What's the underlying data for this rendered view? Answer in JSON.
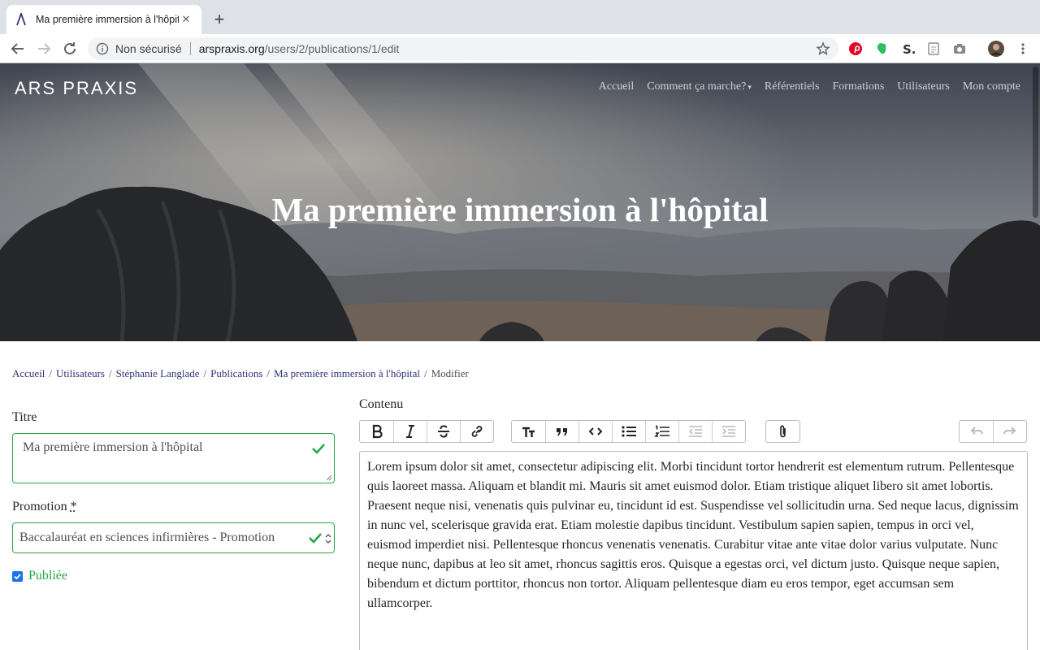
{
  "browser": {
    "tab_title": "Ma première immersion à l'hôpital",
    "close_glyph": "✕",
    "new_tab_glyph": "+",
    "security_label": "Non sécurisé",
    "url_host": "arspraxis.org",
    "url_path": "/users/2/publications/1/edit",
    "extensions": [
      "pinterest-icon",
      "evernote-icon",
      "dollar-icon",
      "document-icon",
      "camera-icon",
      "profile-avatar",
      "menu-icon"
    ]
  },
  "header": {
    "brand": "ARS PRAXIS",
    "nav": [
      {
        "label": "Accueil"
      },
      {
        "label": "Comment ça marche?",
        "dropdown": true,
        "caret": "▾"
      },
      {
        "label": "Référentiels"
      },
      {
        "label": "Formations"
      },
      {
        "label": "Utilisateurs"
      },
      {
        "label": "Mon compte"
      }
    ],
    "page_title": "Ma première immersion à l'hôpital"
  },
  "breadcrumb": {
    "items": [
      "Accueil",
      "Utilisateurs",
      "Stéphanie Langlade",
      "Publications",
      "Ma première immersion à l'hôpital"
    ],
    "current": "Modifier",
    "separator": "/"
  },
  "form": {
    "title_label": "Titre",
    "title_value": "Ma première immersion à l'hôpital",
    "promotion_label": "Promotion",
    "required_mark": "*",
    "promotion_value": "Baccalauréat en sciences infirmières - Promotion",
    "published_label": "Publiée",
    "published_checked": true,
    "content_label": "Contenu",
    "valid_color": "#28a745"
  },
  "editor": {
    "toolbar": [
      "bold-icon",
      "italic-icon",
      "strikethrough-icon",
      "link-icon",
      "heading-icon",
      "quote-icon",
      "code-icon",
      "bullet-list-icon",
      "number-list-icon",
      "decrease-indent-icon",
      "increase-indent-icon",
      "attach-icon",
      "undo-icon",
      "redo-icon"
    ],
    "content": "Lorem ipsum dolor sit amet, consectetur adipiscing elit. Morbi tincidunt tortor hendrerit est elementum rutrum. Pellentesque quis laoreet massa. Aliquam et blandit mi. Mauris sit amet euismod dolor. Etiam tristique aliquet libero sit amet lobortis. Praesent neque nisi, venenatis quis pulvinar eu, tincidunt id est. Suspendisse vel sollicitudin urna. Sed neque lacus, dignissim in nunc vel, scelerisque gravida erat. Etiam molestie dapibus tincidunt. Vestibulum sapien sapien, tempus in orci vel, euismod imperdiet nisi. Pellentesque rhoncus venenatis venenatis. Curabitur vitae ante vitae dolor varius vulputate. Nunc neque nunc, dapibus at leo sit amet, rhoncus sagittis eros. Quisque a egestas orci, vel dictum justo. Quisque neque sapien, bibendum et dictum porttitor, rhoncus non tortor. Aliquam pellentesque diam eu eros tempor, eget accumsan sem ullamcorper."
  }
}
